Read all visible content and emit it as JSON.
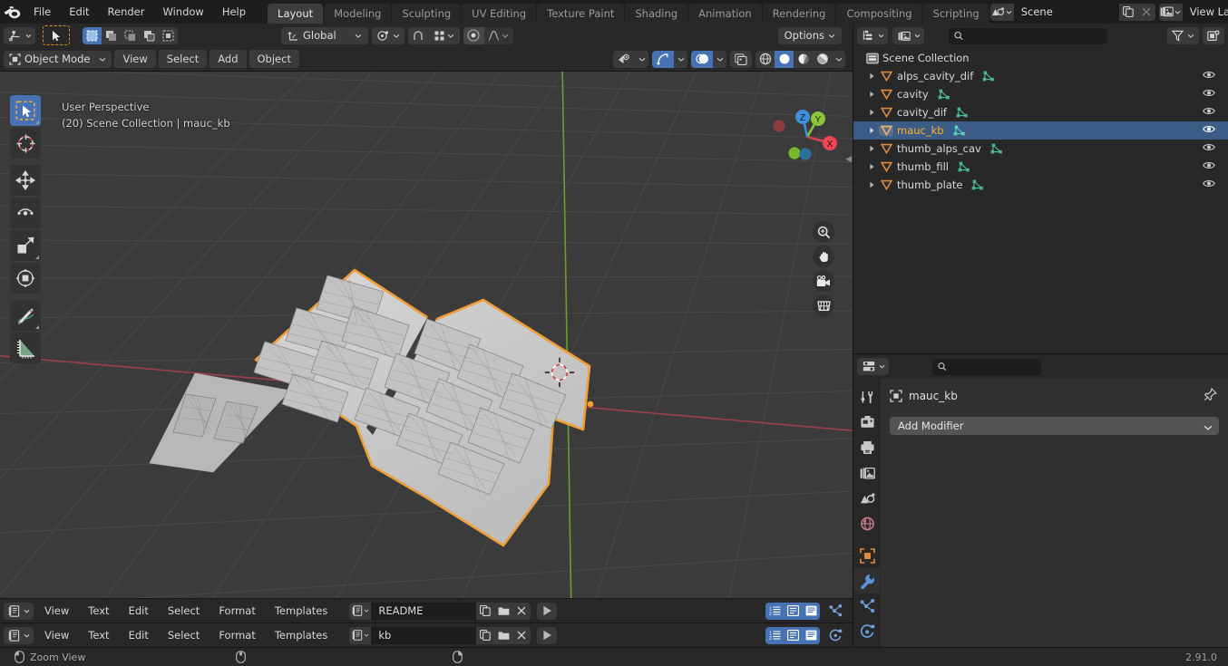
{
  "app": {
    "version": "2.91.0",
    "logo_name": "blender-logo"
  },
  "topbar": {
    "menus": [
      "File",
      "Edit",
      "Render",
      "Window",
      "Help"
    ],
    "workspaces": [
      {
        "label": "Layout",
        "active": true
      },
      {
        "label": "Modeling",
        "active": false
      },
      {
        "label": "Sculpting",
        "active": false
      },
      {
        "label": "UV Editing",
        "active": false
      },
      {
        "label": "Texture Paint",
        "active": false
      },
      {
        "label": "Shading",
        "active": false
      },
      {
        "label": "Animation",
        "active": false
      },
      {
        "label": "Rendering",
        "active": false
      },
      {
        "label": "Compositing",
        "active": false
      },
      {
        "label": "Scripting",
        "active": false
      }
    ],
    "scene": {
      "name": "Scene",
      "icon": "scene-icon",
      "new_icon": "duplicate-icon",
      "unlink_icon": "close-icon"
    },
    "view_layer": {
      "name": "View Layer",
      "icon": "view-layer-icon",
      "new_icon": "duplicate-icon",
      "unlink_icon": "close-icon"
    }
  },
  "viewport": {
    "header": {
      "editor_type_icon": "editor-type-3dview-icon",
      "mode": "Object Mode",
      "mode_icon": "object-mode-icon",
      "menus": [
        "View",
        "Select",
        "Add",
        "Object"
      ],
      "select_modes": [
        "set-select-icon",
        "extend-select-icon",
        "subtract-select-icon",
        "invert-select-icon",
        "intersect-select-icon"
      ],
      "transform_orientation": "Global",
      "transform_orientation_icon": "orientation-global-icon",
      "pivot_icon": "pivot-point-icon",
      "snap_icon": "snap-magnet-icon",
      "snap_target_icon": "snap-increment-icon",
      "proportional_icon": "proportional-edit-icon",
      "falloff_icon": "proportional-falloff-icon",
      "options_label": "Options",
      "visibility_icon": "object-visibility-icon",
      "gizmo_icon": "gizmo-icon",
      "overlays_icon": "overlays-icon",
      "xray_icon": "xray-toggle-icon",
      "shading_modes": [
        "wireframe-shading-icon",
        "solid-shading-icon",
        "material-shading-icon",
        "rendered-shading-icon"
      ],
      "shading_active_index": 1
    },
    "overlay_line1": "User Perspective",
    "overlay_line2": "(20) Scene Collection | mauc_kb",
    "toolbar": [
      {
        "name": "tweak-select-box-tool",
        "active": true
      },
      {
        "name": "cursor-tool",
        "active": false
      },
      {
        "name": "move-tool",
        "active": false
      },
      {
        "name": "rotate-tool",
        "active": false
      },
      {
        "name": "scale-tool",
        "active": false
      },
      {
        "name": "transform-tool",
        "active": false
      },
      {
        "name": "annotate-tool",
        "active": false
      },
      {
        "name": "measure-tool",
        "active": false
      }
    ],
    "nav_buttons": [
      "zoom-view-icon",
      "pan-view-icon",
      "camera-view-icon",
      "toggle-perspective-icon"
    ],
    "gizmo_axes": [
      "X",
      "Y",
      "Z"
    ],
    "colors": {
      "background": "#3b3b3b",
      "grid": "#4a4a4a",
      "axis_x": "#cc4350",
      "axis_y": "#7fbd31",
      "selection_outline": "#ed9a4c",
      "object_fill": "#c9c9c9"
    }
  },
  "outliner": {
    "display_mode_icon": "outliner-display-mode-icon",
    "filter_id_icon": "filter-id-icon",
    "search_placeholder": "",
    "search_value": "",
    "filter_icon": "filter-funnel-icon",
    "new_collection_icon": "new-collection-icon",
    "root": {
      "label": "Scene Collection",
      "icon": "scene-collection-icon"
    },
    "items": [
      {
        "label": "alps_cavity_dif",
        "icon": "mesh-object-icon",
        "data_icon": "mesh-data-icon",
        "selected": false,
        "visible": true
      },
      {
        "label": "cavity",
        "icon": "mesh-object-icon",
        "data_icon": "mesh-data-icon",
        "selected": false,
        "visible": true
      },
      {
        "label": "cavity_dif",
        "icon": "mesh-object-icon",
        "data_icon": "mesh-data-icon",
        "selected": false,
        "visible": true
      },
      {
        "label": "mauc_kb",
        "icon": "mesh-object-icon",
        "data_icon": "mesh-data-icon",
        "selected": true,
        "visible": true
      },
      {
        "label": "thumb_alps_cav",
        "icon": "mesh-object-icon",
        "data_icon": "mesh-data-icon",
        "selected": false,
        "visible": true
      },
      {
        "label": "thumb_fill",
        "icon": "mesh-object-icon",
        "data_icon": "mesh-data-icon",
        "selected": false,
        "visible": true
      },
      {
        "label": "thumb_plate",
        "icon": "mesh-object-icon",
        "data_icon": "mesh-data-icon",
        "selected": false,
        "visible": true
      }
    ]
  },
  "properties": {
    "editor_type_icon": "editor-type-properties-icon",
    "search_placeholder": "",
    "search_value": "",
    "tabs": [
      {
        "name": "tool-properties-tab",
        "active": false
      },
      {
        "name": "render-properties-tab",
        "active": false
      },
      {
        "name": "output-properties-tab",
        "active": false
      },
      {
        "name": "view-layer-properties-tab",
        "active": false
      },
      {
        "name": "scene-properties-tab",
        "active": false
      },
      {
        "name": "world-properties-tab",
        "active": false
      },
      {
        "name": "object-properties-tab",
        "active": false
      },
      {
        "name": "modifier-properties-tab",
        "active": true
      },
      {
        "name": "particles-properties-tab",
        "active": false
      },
      {
        "name": "physics-properties-tab",
        "active": false
      }
    ],
    "breadcrumb_object": "mauc_kb",
    "breadcrumb_icon": "object-icon",
    "pin_icon": "pin-icon",
    "add_modifier_label": "Add Modifier",
    "add_modifier_caret": "chevron-down-icon"
  },
  "text_editors": [
    {
      "editor_type_icon": "editor-type-text-icon",
      "menus": [
        "View",
        "Text",
        "Edit",
        "Select",
        "Format",
        "Templates"
      ],
      "datablock_icon": "text-datablock-icon",
      "filename": "README",
      "new_icon": "duplicate-icon",
      "open_icon": "folder-open-icon",
      "unlink_icon": "close-icon",
      "run_icon": "run-script-icon",
      "toggles": [
        "line-numbers-icon",
        "word-wrap-icon",
        "syntax-highlight-icon"
      ],
      "right_icon": "node-editor-icon"
    },
    {
      "editor_type_icon": "editor-type-text-icon",
      "menus": [
        "View",
        "Text",
        "Edit",
        "Select",
        "Format",
        "Templates"
      ],
      "datablock_icon": "text-datablock-icon",
      "filename": "kb",
      "new_icon": "duplicate-icon",
      "open_icon": "folder-open-icon",
      "unlink_icon": "close-icon",
      "run_icon": "run-script-icon",
      "toggles": [
        "line-numbers-icon",
        "word-wrap-icon",
        "syntax-highlight-icon"
      ],
      "right_icon": "physics-icon"
    }
  ],
  "statusbar": {
    "hints": [
      {
        "icon": "mouse-left-icon",
        "label": "Zoom View"
      },
      {
        "icon": "mouse-middle-icon",
        "label": ""
      },
      {
        "icon": "mouse-right-icon",
        "label": ""
      }
    ],
    "version_label": "2.91.0"
  }
}
